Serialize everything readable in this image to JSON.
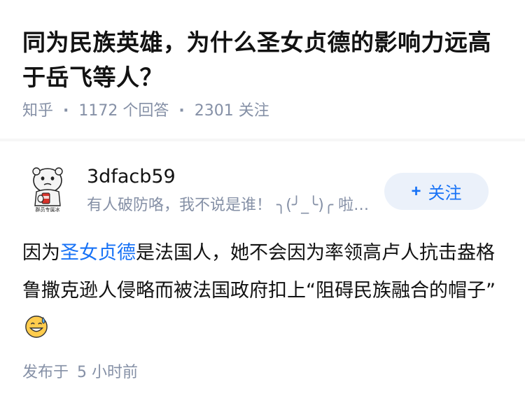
{
  "question": {
    "title": "同为民族英雄，为什么圣女贞德的影响力远高于岳飞等人？",
    "source": "知乎",
    "answer_count": "1172",
    "answer_label": "个回答",
    "follower_count": "2301",
    "follower_label": "关注"
  },
  "answer": {
    "author": {
      "name": "3dfacb59",
      "bio": "有人破防咯，我不说是谁！ ╮(╯_╰)╭ 啦啦啦",
      "avatar_caption": "群员专属冰",
      "avatar_icon": "cartoon-avatar-icon"
    },
    "follow_button": {
      "plus": "+",
      "label": "关注"
    },
    "content": {
      "part1": "因为",
      "link": "圣女贞德",
      "part2": "是法国人，她不会因为率领高卢人抗击盎格鲁撒克逊人侵略而被法国政府扣上“阻碍民族融合的帽子”",
      "emoji": "grinning-sweat-emoji"
    },
    "time": {
      "label": "发布于",
      "value": "5 小时前"
    }
  },
  "colors": {
    "accent": "#1772f6",
    "button_bg": "#ebf1fa",
    "meta_gray": "#8590a6",
    "text": "#121212",
    "divider": "#f6f6f6"
  }
}
